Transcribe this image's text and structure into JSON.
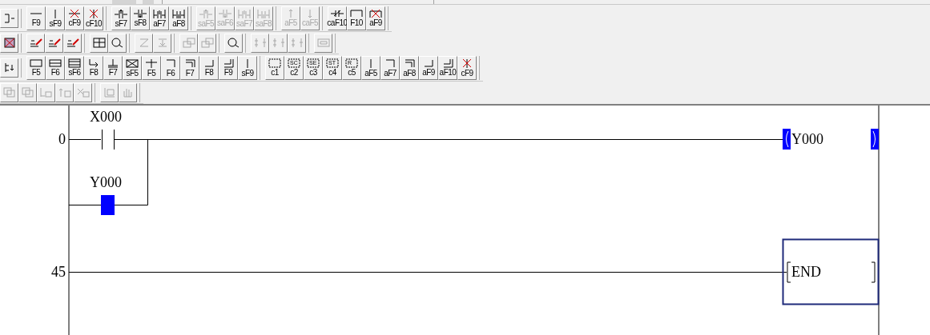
{
  "toolbars": [
    {
      "groups": [
        [
          {
            "kind": "bracket",
            "disabled": false
          }
        ],
        [
          {
            "label": "F9",
            "kind": "hline",
            "disabled": false
          },
          {
            "label": "sF9",
            "kind": "vline",
            "disabled": false
          },
          {
            "label": "cF9",
            "kind": "del-hline",
            "disabled": false
          },
          {
            "label": "cF10",
            "kind": "del-vline",
            "disabled": false
          }
        ],
        [
          {
            "label": "sF7",
            "kind": "rise",
            "disabled": false
          },
          {
            "label": "sF8",
            "kind": "fall",
            "disabled": false
          },
          {
            "label": "aF7",
            "kind": "rise-par",
            "disabled": false
          },
          {
            "label": "aF8",
            "kind": "fall-par",
            "disabled": false
          }
        ],
        [
          {
            "label": "saF5",
            "kind": "rise",
            "disabled": true
          },
          {
            "label": "saF6",
            "kind": "fall",
            "disabled": true
          },
          {
            "label": "saF7",
            "kind": "rise-par",
            "disabled": true
          },
          {
            "label": "saF8",
            "kind": "fall-par",
            "disabled": true
          }
        ],
        [
          {
            "label": "aF5",
            "kind": "arrow-up",
            "disabled": true
          },
          {
            "label": "caF5",
            "kind": "arrow-down",
            "disabled": true
          }
        ],
        [
          {
            "label": "caF10",
            "kind": "invert",
            "disabled": false
          },
          {
            "label": "F10",
            "kind": "draw-line",
            "disabled": false
          },
          {
            "label": "aF9",
            "kind": "del-line",
            "disabled": false
          }
        ]
      ]
    },
    {
      "groups": [
        [
          {
            "kind": "x-box",
            "disabled": false
          }
        ],
        [
          {
            "kind": "pencil",
            "disabled": false
          },
          {
            "kind": "pencil",
            "disabled": false
          },
          {
            "kind": "pencil",
            "disabled": false
          }
        ],
        [
          {
            "kind": "grid",
            "disabled": false
          },
          {
            "kind": "magnifier",
            "disabled": false
          }
        ],
        [
          {
            "kind": "zigzag",
            "disabled": true
          },
          {
            "kind": "down-bar",
            "disabled": true
          }
        ],
        [
          {
            "kind": "window",
            "disabled": true
          },
          {
            "kind": "window",
            "disabled": true
          }
        ],
        [
          {
            "kind": "magnifier",
            "disabled": false
          }
        ],
        [
          {
            "kind": "ladder",
            "disabled": true
          },
          {
            "kind": "ladder",
            "disabled": true
          },
          {
            "kind": "ladder",
            "disabled": true
          }
        ],
        [
          {
            "kind": "screen",
            "disabled": true
          }
        ]
      ]
    },
    {
      "groups": [
        [
          {
            "kind": "tree",
            "disabled": false
          }
        ],
        [
          {
            "label": "F5",
            "kind": "rect",
            "disabled": false
          },
          {
            "label": "F6",
            "kind": "rect2",
            "disabled": false
          },
          {
            "label": "sF6",
            "kind": "rect3",
            "disabled": false
          },
          {
            "label": "F8",
            "kind": "branch",
            "disabled": false
          },
          {
            "label": "F7",
            "kind": "tee",
            "disabled": false
          },
          {
            "label": "sF5",
            "kind": "xrect",
            "disabled": false
          },
          {
            "label": "F5",
            "kind": "plus",
            "disabled": false
          },
          {
            "label": "F6",
            "kind": "corner",
            "disabled": false
          },
          {
            "label": "F7",
            "kind": "corner2",
            "disabled": false
          },
          {
            "label": "F8",
            "kind": "corner-up",
            "disabled": false
          },
          {
            "label": "F9",
            "kind": "corner-up2",
            "disabled": false
          },
          {
            "label": "sF9",
            "kind": "vline",
            "disabled": false
          }
        ],
        [
          {
            "label": "c1",
            "kind": "dashed",
            "disabled": false
          },
          {
            "label": "c2",
            "kind": "dashed",
            "box_text": "SC",
            "disabled": false
          },
          {
            "label": "c3",
            "kind": "dashed",
            "box_text": "SE",
            "disabled": false
          },
          {
            "label": "c4",
            "kind": "dashed",
            "box_text": "ST",
            "disabled": false
          },
          {
            "label": "c5",
            "kind": "dashed",
            "box_text": "R",
            "disabled": false
          },
          {
            "label": "aF5",
            "kind": "vline",
            "disabled": false
          },
          {
            "label": "aF7",
            "kind": "corner",
            "disabled": false
          },
          {
            "label": "aF8",
            "kind": "corner2",
            "disabled": false
          },
          {
            "label": "aF9",
            "kind": "corner-up",
            "disabled": false
          },
          {
            "label": "aF10",
            "kind": "corner-up2",
            "disabled": false
          },
          {
            "label": "cF9",
            "kind": "del-vline",
            "disabled": false
          }
        ]
      ]
    },
    {
      "groups": [
        [
          {
            "kind": "pages",
            "disabled": true
          },
          {
            "kind": "pages",
            "disabled": true
          },
          {
            "kind": "bars-down",
            "disabled": true
          },
          {
            "kind": "bars-up",
            "disabled": true
          },
          {
            "kind": "bars-x",
            "disabled": true
          }
        ],
        [
          {
            "kind": "document",
            "disabled": true
          },
          {
            "kind": "hand",
            "disabled": true
          }
        ]
      ]
    }
  ],
  "ladder": {
    "rungs": [
      {
        "step": "0",
        "contacts": [
          {
            "device": "X000",
            "highlighted": false
          },
          {
            "device": "Y000",
            "highlighted": true
          }
        ],
        "coil": {
          "device": "Y000",
          "highlighted": true
        }
      },
      {
        "step": "45",
        "instruction": {
          "text": "END",
          "selected": true
        }
      }
    ]
  }
}
